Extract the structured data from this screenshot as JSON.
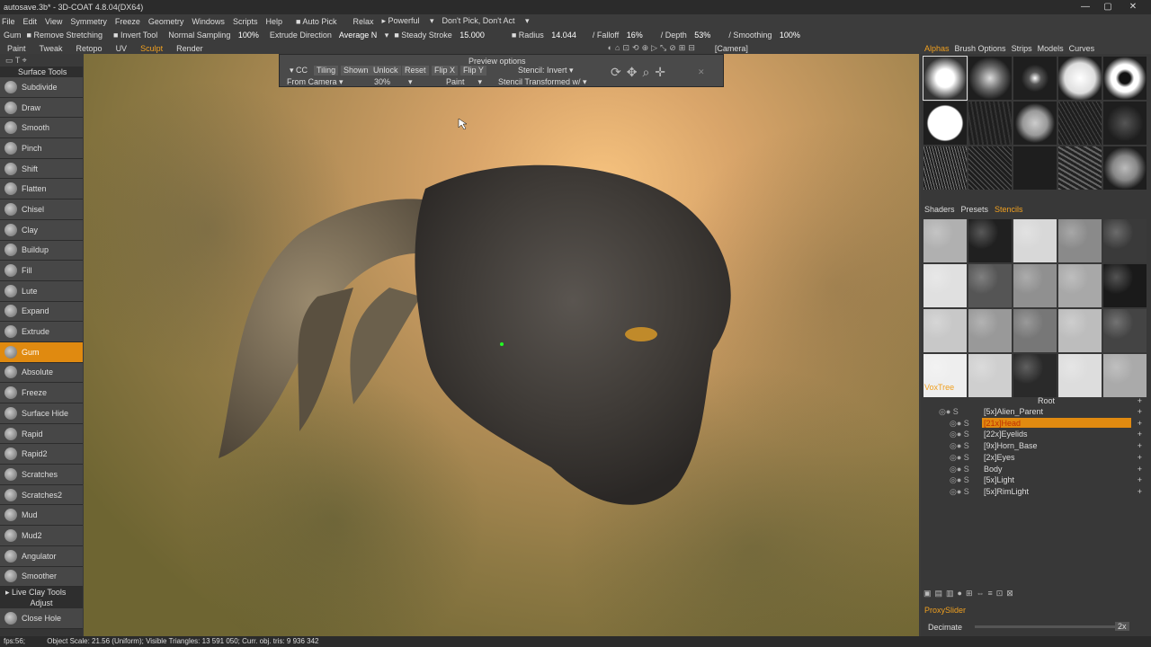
{
  "titlebar": {
    "title": "autosave.3b* - 3D-COAT 4.8.04(DX64)"
  },
  "menu": [
    "File",
    "Edit",
    "View",
    "Symmetry",
    "Freeze",
    "Geometry",
    "Windows",
    "Scripts",
    "Help"
  ],
  "menu_right": {
    "autopick": "Auto Pick",
    "relax": "Relax",
    "powerful": "Powerful",
    "dontpick": "Don't Pick, Don't Act"
  },
  "toolbar": {
    "tool": "Gum",
    "remove_stretching": "Remove Stretching",
    "invert_tool": "Invert Tool",
    "normal_sampling": "Normal Sampling",
    "normal_sampling_val": "100%",
    "extrude_direction": "Extrude Direction",
    "extrude_direction_val": "Average N",
    "steady_stroke": "Steady Stroke",
    "steady_stroke_val": "15.000",
    "radius": "Radius",
    "radius_val": "14.044",
    "falloff": "Falloff",
    "falloff_val": "16%",
    "depth": "Depth",
    "depth_val": "53%",
    "smoothing": "Smoothing",
    "smoothing_val": "100%"
  },
  "modetabs": [
    "Paint",
    "Tweak",
    "Retopo",
    "UV",
    "Sculpt",
    "Render"
  ],
  "active_mode": "Sculpt",
  "camera_select": "[Camera]",
  "right_tabs1": [
    "Alphas",
    "Brush Options",
    "Strips",
    "Models",
    "Curves"
  ],
  "left": {
    "header": "Surface Tools",
    "tools": [
      "Subdivide",
      "Draw",
      "Smooth",
      "Pinch",
      "Shift",
      "Flatten",
      "Chisel",
      "Clay",
      "Buildup",
      "Fill",
      "Lute",
      "Expand",
      "Extrude",
      "Gum",
      "Absolute",
      "Freeze",
      "Surface Hide",
      "Rapid",
      "Rapid2",
      "Scratches",
      "Scratches2",
      "Mud",
      "Mud2",
      "Angulator",
      "Smoother"
    ],
    "active": "Gum",
    "live_clay": "Live Clay Tools",
    "adjust": "Adjust",
    "close_hole": "Close Hole"
  },
  "preview": {
    "title": "Preview options",
    "cc": "CC",
    "tiling": "Tiling",
    "shown": "Shown",
    "unlock": "Unlock",
    "reset": "Reset",
    "flipx": "Flip X",
    "flipy": "Flip Y",
    "stencil": "Stencil: Invert",
    "from": "From Camera",
    "pct": "30%",
    "paint": "Paint",
    "stencil_tr": "Stencil Transformed w/",
    "close": "CLOSE"
  },
  "right_tabs2": [
    "Shaders",
    "Presets",
    "Stencils"
  ],
  "voxtree": {
    "title": "VoxTree",
    "root": "Root",
    "items": [
      "[5x]Alien_Parent",
      "[21x]Head",
      "[22x]Eyelids",
      "[9x]Horn_Base",
      "[2x]Eyes",
      "Body",
      "[5x]Light",
      "[5x]RimLight"
    ],
    "selected": "[21x]Head"
  },
  "proxy": {
    "title": "ProxySlider",
    "decimate": "Decimate",
    "decimate_val": "2x"
  },
  "status": {
    "fps": "fps:56;",
    "info": "Object Scale: 21.56 (Uniform); Visible Triangles: 13 591 050; Curr. obj. tris: 9 936 342"
  },
  "colors": {
    "accent": "#e08a10",
    "tab_active": "#f0a020"
  }
}
